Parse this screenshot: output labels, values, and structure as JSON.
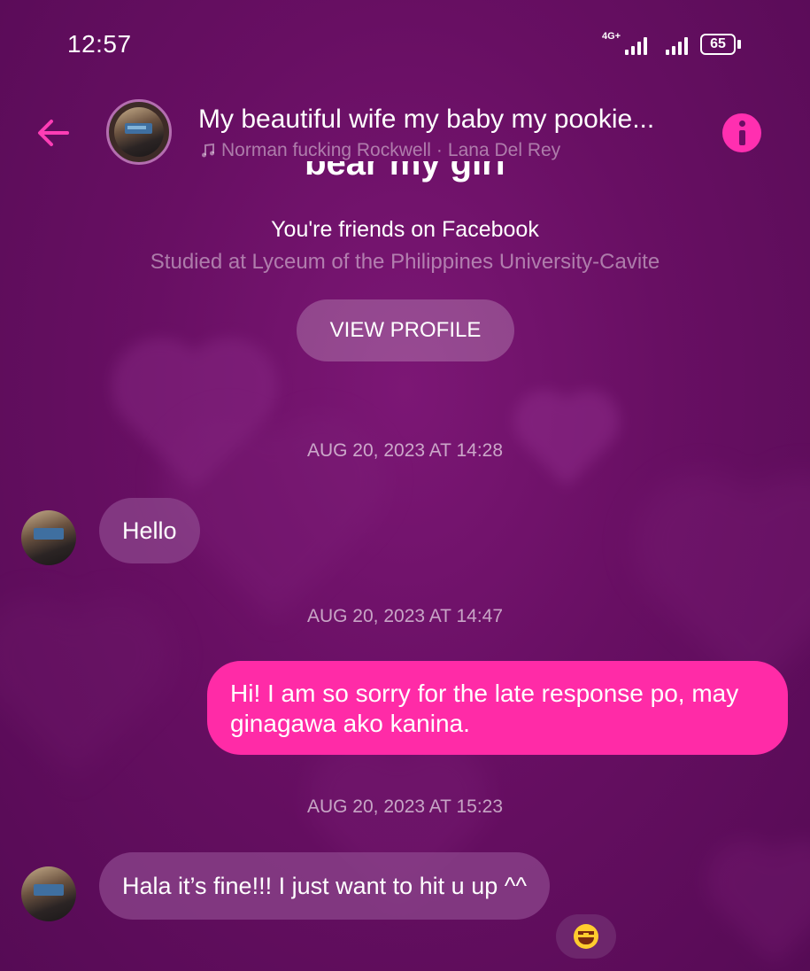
{
  "status_bar": {
    "time": "12:57",
    "network_label": "4G+",
    "battery": "65"
  },
  "header": {
    "title": "My beautiful wife my baby my pookie...",
    "song": "Norman fucking Rockwell",
    "artist_sep": "·",
    "artist": "Lana Del Rey"
  },
  "profile": {
    "name_partial": "bear my girl",
    "friends_text": "You're friends on Facebook",
    "studied_text": "Studied at Lyceum of the Philippines University-Cavite",
    "view_profile_label": "VIEW PROFILE"
  },
  "messages": [
    {
      "timestamp": "AUG 20, 2023 AT 14:28",
      "direction": "incoming",
      "text": "Hello"
    },
    {
      "timestamp": "AUG 20, 2023 AT 14:47",
      "direction": "outgoing",
      "text": "Hi! I am so sorry for the late response po, may ginagawa ako kanina."
    },
    {
      "timestamp": "AUG 20, 2023 AT 15:23",
      "direction": "incoming",
      "text": "Hala it’s fine!!! I just want to hit u up ^^",
      "reaction": "laughing-emoji"
    }
  ],
  "colors": {
    "background": "#680f63",
    "accent": "#ff2ba7",
    "incoming_bubble": "#8c468c"
  },
  "icons": {
    "back": "back-arrow-icon",
    "info": "info-icon",
    "music": "music-note-icon"
  }
}
